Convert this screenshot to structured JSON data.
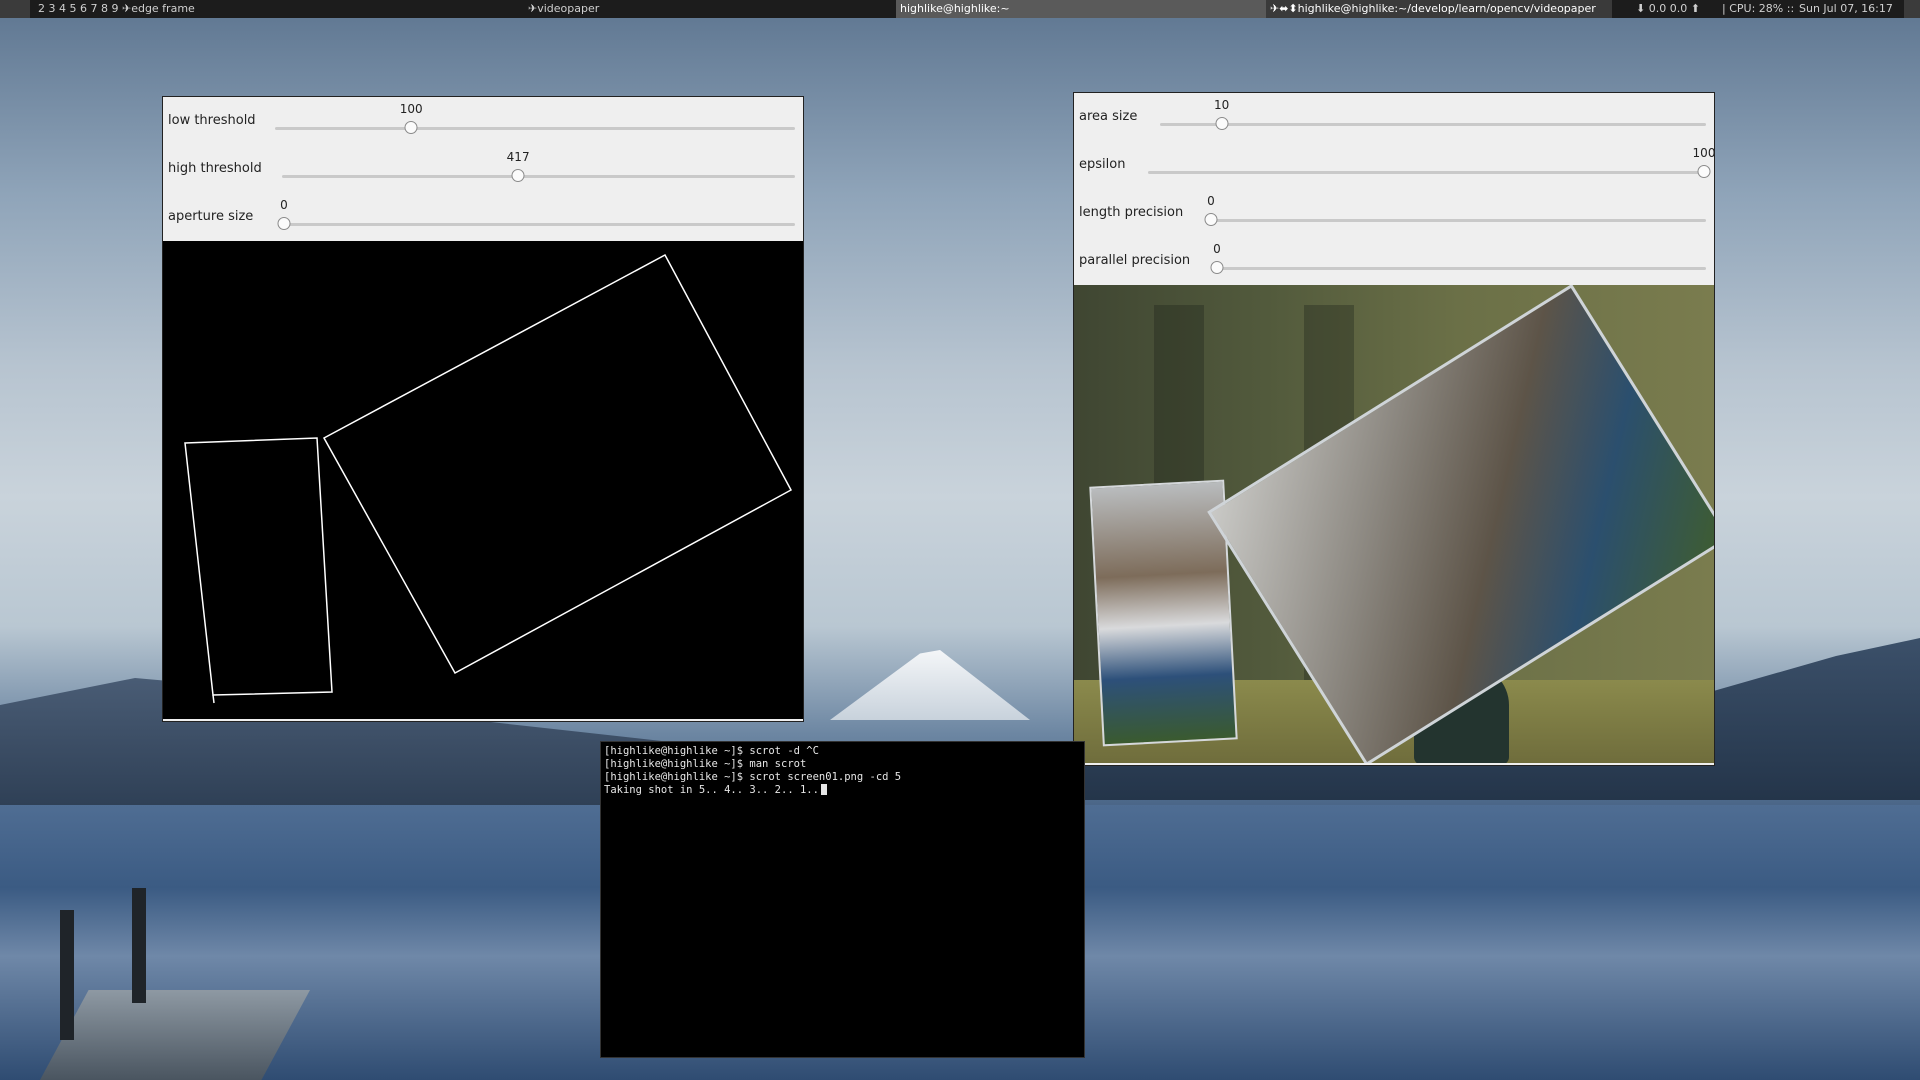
{
  "topbar": {
    "workspaces": "2 3 4 5 6 7 8 9",
    "active_workspace": "edge frame",
    "window_title_1": "videopaper",
    "window_title_2": "highlike@highlike:~",
    "window_title_3": "highlike@highlike:~/develop/learn/opencv/videopaper",
    "network": "0.0 0.0",
    "cpu": "CPU: 28%",
    "separator": "::",
    "datetime": "Sun Jul 07, 16:17",
    "title_prefix_icon": "plane-icon",
    "network_icons": [
      "download-arrow-icon",
      "upload-arrow-icon"
    ]
  },
  "edge_window": {
    "trackbars": [
      {
        "label": "low threshold",
        "value": "100"
      },
      {
        "label": "high threshold",
        "value": "417"
      },
      {
        "label": "aperture size",
        "value": "0"
      }
    ],
    "trackbar_fill": [
      0.26,
      0.46,
      0.0
    ]
  },
  "video_window": {
    "trackbars": [
      {
        "label": "area size",
        "value": "10"
      },
      {
        "label": "epsilon",
        "value": "100"
      },
      {
        "label": "length precision",
        "value": "0"
      },
      {
        "label": "parallel precision",
        "value": "0"
      }
    ],
    "trackbar_fill": [
      0.11,
      1.0,
      0.0,
      0.0
    ]
  },
  "terminal": {
    "lines": [
      "[highlike@highlike ~]$ scrot -d ^C",
      "[highlike@highlike ~]$ man scrot",
      "[highlike@highlike ~]$ scrot screen01.png -cd 5",
      "Taking shot in 5.. 4.. 3.. 2.. 1.."
    ]
  }
}
